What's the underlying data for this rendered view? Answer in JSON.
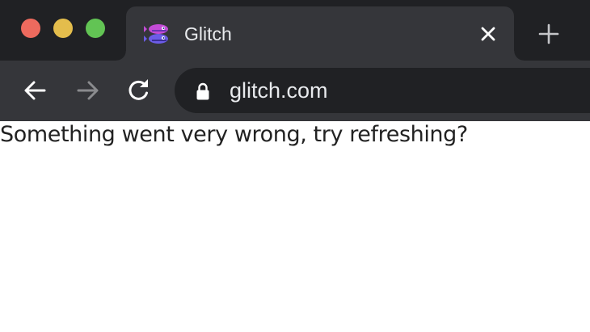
{
  "colors": {
    "tabstrip_bg": "#202124",
    "active_tab_bg": "#35363a",
    "toolbar_bg": "#35363a",
    "omnibox_bg": "#202124",
    "text_light": "#e8eaed",
    "icon_disabled": "#8a8b8e",
    "traffic_close": "#ed6a5e",
    "traffic_minimize": "#e4bd4c",
    "traffic_maximize": "#62c454",
    "page_bg": "#ffffff",
    "page_text": "#222222"
  },
  "window": {
    "traffic_lights": [
      {
        "name": "close",
        "icon": "traffic-light-close"
      },
      {
        "name": "minimize",
        "icon": "traffic-light-minimize"
      },
      {
        "name": "maximize",
        "icon": "traffic-light-maximize"
      }
    ]
  },
  "tabs": [
    {
      "title": "Glitch",
      "favicon": "glitch-fish-icon",
      "active": true,
      "close_icon": "close-icon"
    }
  ],
  "new_tab_icon": "plus-icon",
  "toolbar": {
    "back_icon": "back-arrow-icon",
    "forward_icon": "forward-arrow-icon",
    "forward_enabled": false,
    "reload_icon": "reload-icon",
    "address": {
      "secure_icon": "lock-icon",
      "url": "glitch.com"
    }
  },
  "page": {
    "message": "Something went very wrong, try refreshing?"
  }
}
